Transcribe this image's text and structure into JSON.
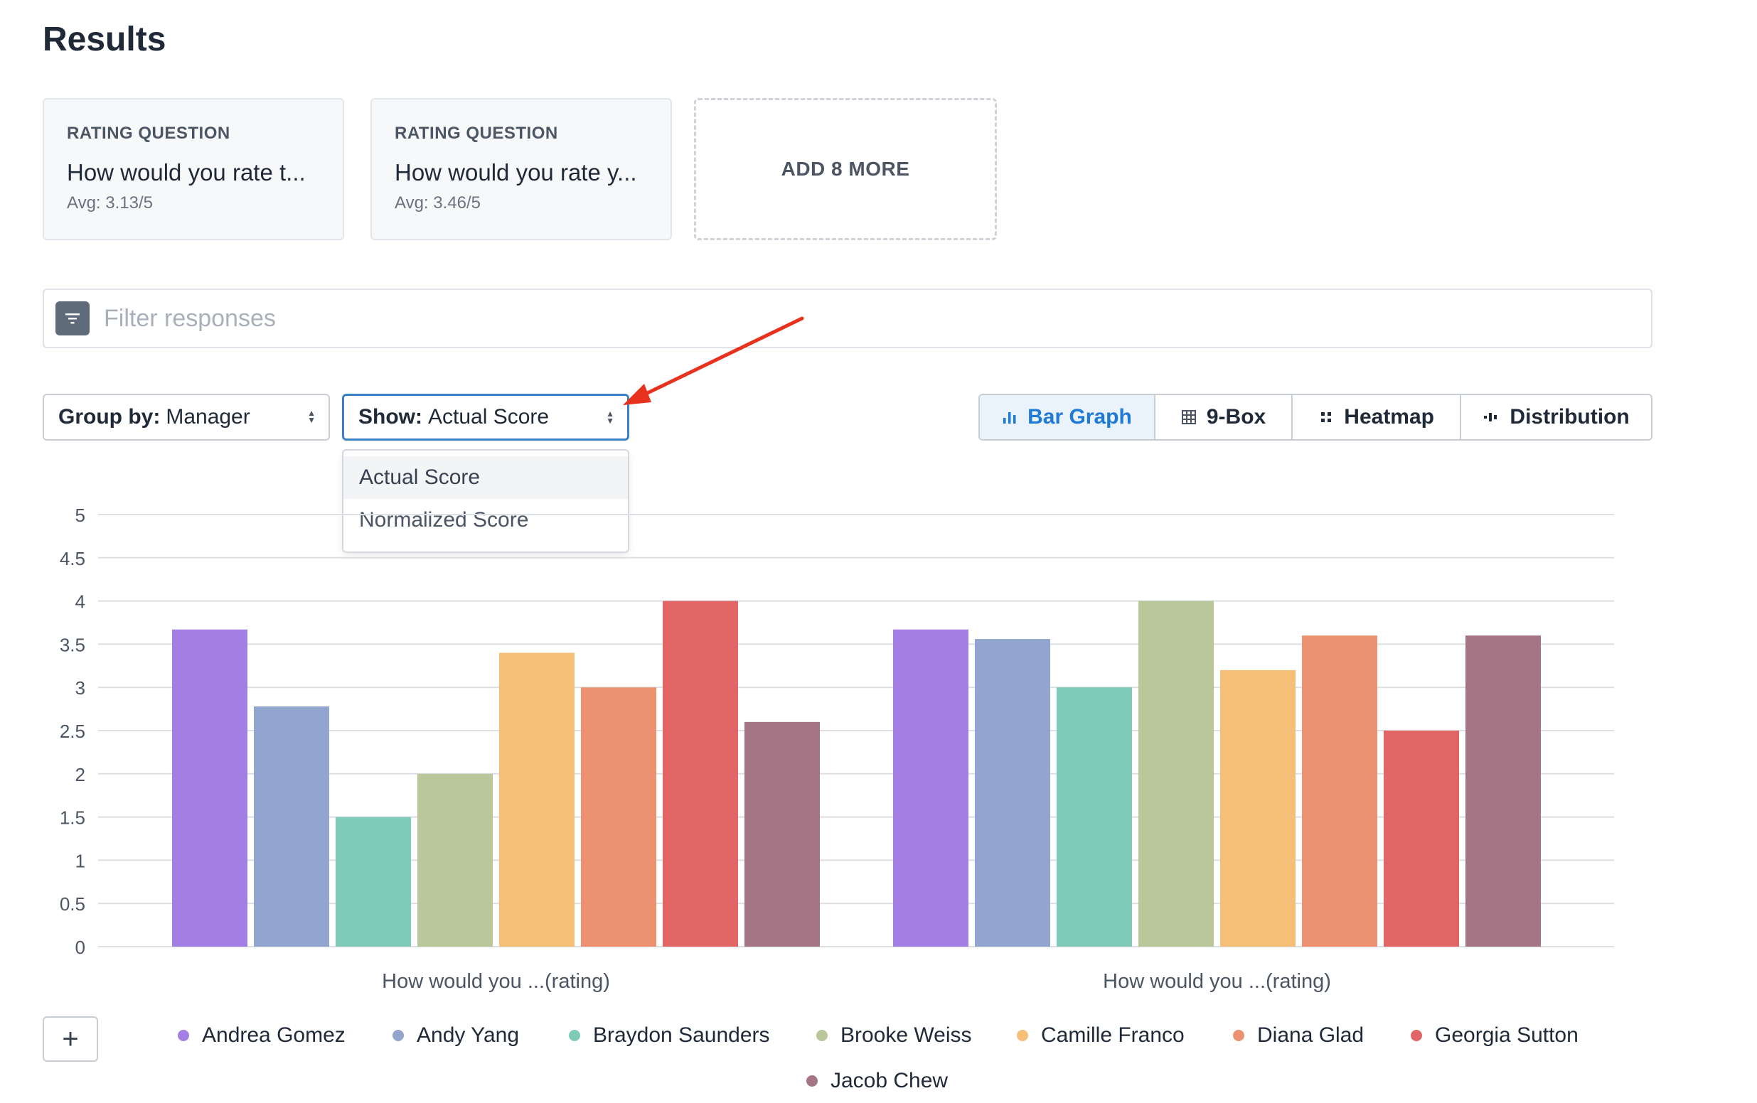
{
  "page": {
    "title": "Results"
  },
  "cards": [
    {
      "type": "RATING QUESTION",
      "question": "How would you rate t...",
      "avg": "Avg: 3.13/5"
    },
    {
      "type": "RATING QUESTION",
      "question": "How would you rate y...",
      "avg": "Avg: 3.46/5"
    }
  ],
  "add_more": {
    "label": "ADD 8 MORE"
  },
  "filter": {
    "placeholder": "Filter responses"
  },
  "group_by": {
    "label": "Group by:",
    "value": "Manager"
  },
  "show": {
    "label": "Show:",
    "value": "Actual Score",
    "options": [
      "Actual Score",
      "Normalized Score"
    ]
  },
  "views": [
    {
      "label": "Bar Graph",
      "icon": "bar-graph-icon"
    },
    {
      "label": "9-Box",
      "icon": "grid-icon"
    },
    {
      "label": "Heatmap",
      "icon": "heatmap-icon"
    },
    {
      "label": "Distribution",
      "icon": "distribution-icon"
    }
  ],
  "colors": {
    "accent": "#1e7ad6",
    "annotation_arrow": "#e8321e"
  },
  "chart_data": {
    "type": "bar",
    "categories": [
      "How would you ...(rating)",
      "How would you ...(rating)"
    ],
    "ylim": [
      0,
      5
    ],
    "yticks": [
      "0",
      "0.5",
      "1",
      "1.5",
      "2",
      "2.5",
      "3",
      "3.5",
      "4",
      "4.5",
      "5"
    ],
    "grid": true,
    "legend_position": "bottom",
    "series": [
      {
        "name": "Andrea Gomez",
        "color": "#a47fe3",
        "values": [
          3.67,
          3.67
        ]
      },
      {
        "name": "Andy Yang",
        "color": "#92a5cf",
        "values": [
          2.78,
          3.56
        ]
      },
      {
        "name": "Braydon Saunders",
        "color": "#7fcbb8",
        "values": [
          1.5,
          3.0
        ]
      },
      {
        "name": "Brooke Weiss",
        "color": "#b9c79a",
        "values": [
          2.0,
          4.0
        ]
      },
      {
        "name": "Camille Franco",
        "color": "#f5bf77",
        "values": [
          3.4,
          3.2
        ]
      },
      {
        "name": "Diana Glad",
        "color": "#ed9270",
        "values": [
          3.0,
          3.6
        ]
      },
      {
        "name": "Georgia Sutton",
        "color": "#e26666",
        "values": [
          4.0,
          2.5
        ]
      },
      {
        "name": "Jacob Chew",
        "color": "#a67585",
        "values": [
          2.6,
          3.6
        ]
      }
    ]
  }
}
